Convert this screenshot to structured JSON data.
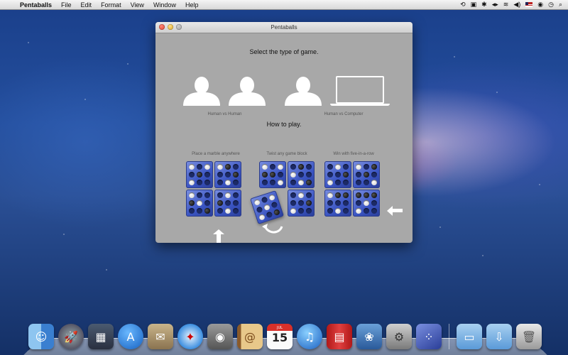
{
  "menubar": {
    "app_name": "Pentaballs",
    "items": [
      "File",
      "Edit",
      "Format",
      "View",
      "Window",
      "Help"
    ]
  },
  "window": {
    "title": "Pentaballs",
    "select_heading": "Select the type of game.",
    "modes": [
      {
        "label": "Human vs Human",
        "icon": "two-people-icon"
      },
      {
        "label": "Human vs Computer",
        "icon": "person-and-computer-icon"
      }
    ],
    "howto_heading": "How to play.",
    "steps": [
      {
        "caption": "Place a marble anywhere"
      },
      {
        "caption": "Twist any game block"
      },
      {
        "caption": "Win with five-in-a-row"
      }
    ]
  },
  "dock": {
    "calendar_month": "JUL",
    "calendar_day": "15",
    "apps": [
      "finder-icon",
      "launchpad-icon",
      "mission-control-icon",
      "app-store-icon",
      "mail-stamp-icon",
      "safari-icon",
      "facetime-icon",
      "address-book-icon",
      "calendar-icon",
      "itunes-icon",
      "photo-booth-icon",
      "iphoto-icon",
      "system-preferences-icon",
      "pentaballs-icon",
      "applications-folder-icon",
      "downloads-folder-icon",
      "trash-icon"
    ]
  },
  "colors": {
    "window_bg": "#a8a8a8",
    "board_blue": "#3b55c3",
    "menubar": "#e6e6e6"
  }
}
